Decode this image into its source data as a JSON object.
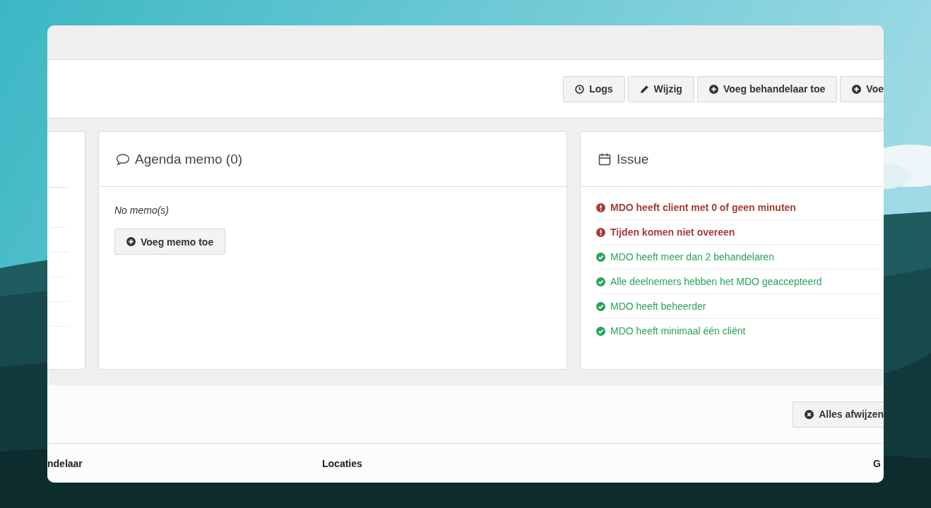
{
  "toolbar": {
    "buttons": [
      {
        "label": "Logs",
        "kind": "clock"
      },
      {
        "label": "Wijzig",
        "kind": "pencil"
      },
      {
        "label": "Voeg behandelaar toe",
        "kind": "plus"
      },
      {
        "label": "Voe",
        "kind": "plus"
      }
    ]
  },
  "memo_panel": {
    "title": "Agenda memo (0)",
    "empty_text": "No memo(s)",
    "button": "Voeg memo toe"
  },
  "issue_panel": {
    "title": "Issue",
    "issues": [
      {
        "text": "MDO heeft client met 0 of geen minuten",
        "kind": "error"
      },
      {
        "text": "Tijden komen niet overeen",
        "kind": "error"
      },
      {
        "text": "MDO heeft meer dan 2 behandelaren",
        "kind": "ok"
      },
      {
        "text": "Alle deelnemers hebben het MDO geaccepteerd",
        "kind": "ok"
      },
      {
        "text": "MDO heeft beheerder",
        "kind": "ok"
      },
      {
        "text": "MDO heeft minimaal één cliënt",
        "kind": "ok"
      }
    ]
  },
  "footer": {
    "button": "Alles afwijzen"
  },
  "table": {
    "columns": [
      "ndelaar",
      "Locaties",
      "G"
    ]
  }
}
